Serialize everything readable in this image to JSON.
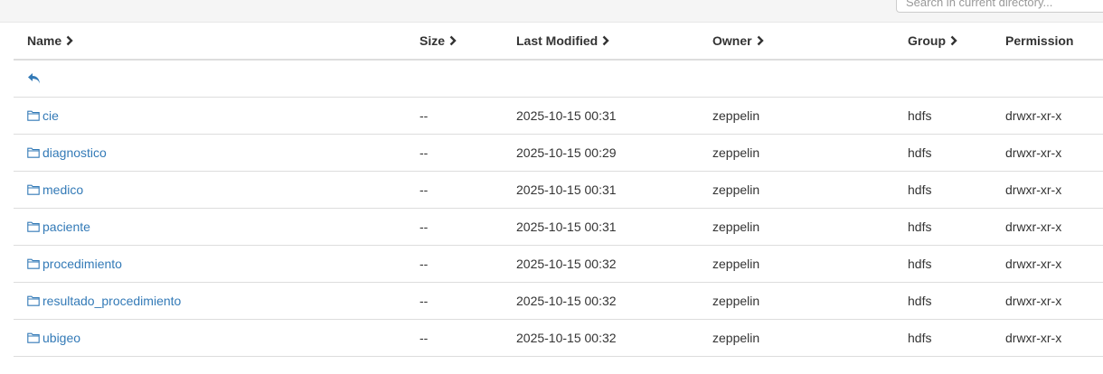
{
  "search": {
    "placeholder": "Search in current directory..."
  },
  "table": {
    "headers": {
      "name": "Name",
      "size": "Size",
      "last_modified": "Last Modified",
      "owner": "Owner",
      "group": "Group",
      "permission": "Permission"
    },
    "rows": [
      {
        "name": "cie",
        "size": "--",
        "last_modified": "2025-10-15 00:31",
        "owner": "zeppelin",
        "group": "hdfs",
        "permission": "drwxr-xr-x"
      },
      {
        "name": "diagnostico",
        "size": "--",
        "last_modified": "2025-10-15 00:29",
        "owner": "zeppelin",
        "group": "hdfs",
        "permission": "drwxr-xr-x"
      },
      {
        "name": "medico",
        "size": "--",
        "last_modified": "2025-10-15 00:31",
        "owner": "zeppelin",
        "group": "hdfs",
        "permission": "drwxr-xr-x"
      },
      {
        "name": "paciente",
        "size": "--",
        "last_modified": "2025-10-15 00:31",
        "owner": "zeppelin",
        "group": "hdfs",
        "permission": "drwxr-xr-x"
      },
      {
        "name": "procedimiento",
        "size": "--",
        "last_modified": "2025-10-15 00:32",
        "owner": "zeppelin",
        "group": "hdfs",
        "permission": "drwxr-xr-x"
      },
      {
        "name": "resultado_procedimiento",
        "size": "--",
        "last_modified": "2025-10-15 00:32",
        "owner": "zeppelin",
        "group": "hdfs",
        "permission": "drwxr-xr-x"
      },
      {
        "name": "ubigeo",
        "size": "--",
        "last_modified": "2025-10-15 00:32",
        "owner": "zeppelin",
        "group": "hdfs",
        "permission": "drwxr-xr-x"
      }
    ]
  },
  "icons": {
    "back": "reply-arrow-icon",
    "folder": "folder-open-outline-icon",
    "sort": "chevron-right-icon"
  },
  "colors": {
    "link": "#337ab7",
    "text": "#333333",
    "border": "#dddddd",
    "topbar": "#f5f5f5"
  }
}
